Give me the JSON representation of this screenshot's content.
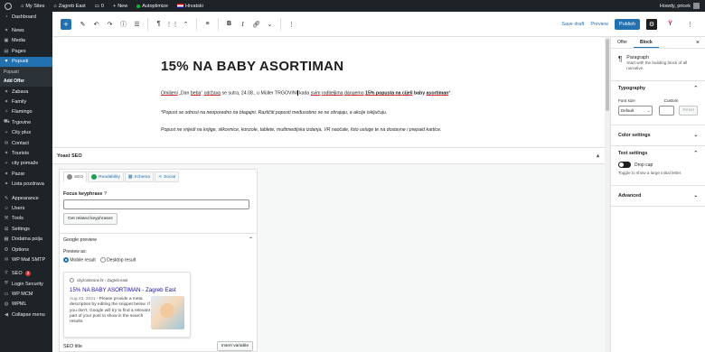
{
  "adminbar": {
    "my_sites": "My Sites",
    "site_name": "Zagreb East",
    "comments_count": "0",
    "new_label": "New",
    "autoptimize": "Autoptimize",
    "language": "Hrvatski",
    "howdy": "Howdy, pricek"
  },
  "sidebar": {
    "items": [
      {
        "label": "Dashboard",
        "icon": "dashboard-icon"
      },
      {
        "label": "News",
        "icon": "pin-icon"
      },
      {
        "label": "Media",
        "icon": "media-icon"
      },
      {
        "label": "Pages",
        "icon": "page-icon"
      },
      {
        "label": "Popusti",
        "icon": "heart-icon",
        "active": true
      },
      {
        "label": "Zabava",
        "icon": "pin-icon"
      },
      {
        "label": "Family",
        "icon": "pin-icon"
      },
      {
        "label": "Flamingo",
        "icon": "bird-icon"
      },
      {
        "label": "Trgovine",
        "icon": "cart-icon"
      },
      {
        "label": "City plus",
        "icon": "plus-icon"
      },
      {
        "label": "Contact",
        "icon": "mail-icon"
      },
      {
        "label": "Tourists",
        "icon": "pin-icon"
      },
      {
        "label": "city pomaže",
        "icon": "plus-icon"
      },
      {
        "label": "Pazar",
        "icon": "pin-icon"
      },
      {
        "label": "Lista pozdrava",
        "icon": "pin-icon"
      },
      {
        "label": "Appearance",
        "icon": "brush-icon"
      },
      {
        "label": "Users",
        "icon": "user-icon"
      },
      {
        "label": "Tools",
        "icon": "wrench-icon"
      },
      {
        "label": "Settings",
        "icon": "settings-icon"
      },
      {
        "label": "Dodatna polja",
        "icon": "grid-icon"
      },
      {
        "label": "Options",
        "icon": "gear-icon"
      },
      {
        "label": "WP Mail SMTP",
        "icon": "mail-icon"
      },
      {
        "label": "SEO",
        "icon": "yoast-icon",
        "badge": "3"
      },
      {
        "label": "Login Security",
        "icon": "shield-icon"
      },
      {
        "label": "WP MCM",
        "icon": "folder-icon"
      },
      {
        "label": "WPML",
        "icon": "globe-icon"
      },
      {
        "label": "Collapse menu",
        "icon": "collapse-icon"
      }
    ],
    "submenu": [
      "Popusti",
      "Add Offer"
    ]
  },
  "toolbar": {
    "paragraph_symbol": "¶",
    "bold": "B",
    "italic": "I",
    "save_draft": "Save draft",
    "preview": "Preview",
    "publish": "Publish"
  },
  "post": {
    "title": "15% NA BABY ASORTIMAN",
    "para1": {
      "w1": "Omiljeni",
      "w2": " „Dan ",
      "w3": "beba",
      "w4": "“ ",
      "w5": "održava",
      "w6": " se sutra, 24.08., u Müller TRGOVINI",
      "w7": " kada ",
      "w8": "svim",
      "w9": " ",
      "w10": "roditeljima",
      "w11": " ",
      "w12": "darujemo",
      "w13": " ",
      "w14": "15% popusta na cijeli",
      "w15": " baby ",
      "w16": "asortiman",
      "w17": "*."
    },
    "para2": "*Popust se odnosi na neoporedno na blagajni. Različiti popusti međusobno se ne zbrajaju, a akcije isključuju.",
    "para3": "Popust ne vrijedi na knjige, slikovnice, konzole, tablete, multimedijska izdanja, VR naočale, foto usluge te na dostavne i prepaid kartice."
  },
  "metabox": {
    "title": "Yoast SEO",
    "toggle": "▴",
    "tabs": [
      "SEO",
      "Readability",
      "Schema",
      "Social"
    ],
    "focus_label": "Focus keyphrase",
    "get_related": "Get related keyphrases",
    "google_preview": "Google preview",
    "preview_as": "Preview as:",
    "mobile_result": "Mobile result",
    "desktop_result": "Desktop result",
    "card_url": "cityzonterone.hr › Zagreb-east",
    "card_title": "15% NA BABY ASORTIMAN - Zagreb East",
    "card_date": "Aug 23, 2021",
    "card_desc": " - Please provide a meta description by editing the snippet below. If you don't, Google will try to find a relevant part of your post to show in the search results.",
    "seo_title": "SEO title",
    "insert_variable": "Insert variable"
  },
  "settings": {
    "tab_offer": "Offer",
    "tab_block": "Block",
    "block_name": "Paragraph",
    "block_desc": "Start with the building block of all narrative.",
    "typography": "Typography",
    "font_size": "Font size",
    "custom": "Custom",
    "default": "Default",
    "reset": "Reset",
    "color_settings": "Color settings",
    "text_settings": "Text settings",
    "drop_cap": "Drop cap",
    "drop_cap_desc": "Toggle to show a large initial letter.",
    "advanced": "Advanced"
  },
  "colors": {
    "wp_blue": "#2271b1",
    "admin_dark": "#1d2327",
    "error_red": "#d63638",
    "yoast_green": "#1f9d55"
  }
}
